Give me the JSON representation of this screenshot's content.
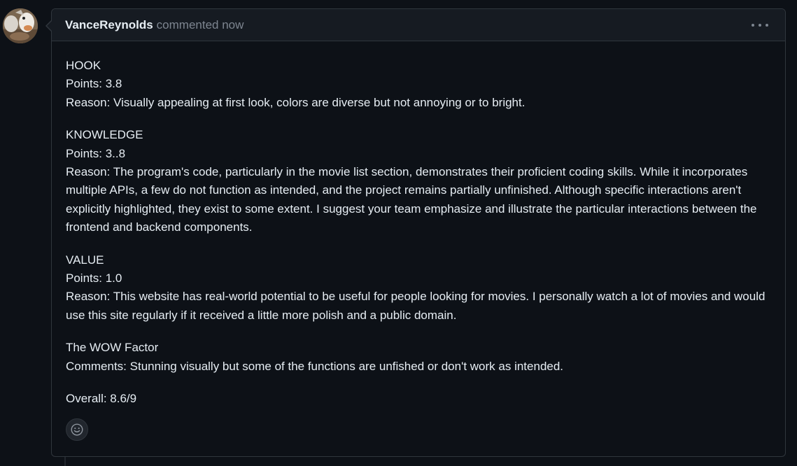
{
  "comment": {
    "author": "VanceReynolds",
    "meta": "commented now",
    "sections": [
      {
        "heading": "HOOK",
        "line2": "Points: 3.8",
        "line3": "Reason: Visually appealing at first look, colors are diverse but not annoying or to bright."
      },
      {
        "heading": "KNOWLEDGE",
        "line2": "Points: 3..8",
        "line3": "Reason: The program's code, particularly in the movie list section, demonstrates their proficient coding skills. While it incorporates multiple APIs, a few do not function as intended, and the project remains partially unfinished. Although specific interactions aren't explicitly highlighted, they exist to some extent. I suggest your team emphasize and illustrate the particular interactions between the frontend and backend components."
      },
      {
        "heading": "VALUE",
        "line2": "Points: 1.0",
        "line3": "Reason: This website has real-world potential to be useful for people looking for movies. I personally watch a lot of movies and would use this site regularly if it received a little more polish and a public domain."
      },
      {
        "heading": "The WOW Factor",
        "line2": "Comments: Stunning visually but some of the functions are unfished or don't work as intended."
      }
    ],
    "overall": "Overall: 8.6/9"
  },
  "icons": {
    "more": "kebab-horizontal-icon",
    "reaction": "smiley-icon"
  },
  "colors": {
    "background": "#0d1117",
    "header_bg": "#161b22",
    "border": "#30363d",
    "text": "#e6edf3",
    "muted": "#7d8590"
  }
}
